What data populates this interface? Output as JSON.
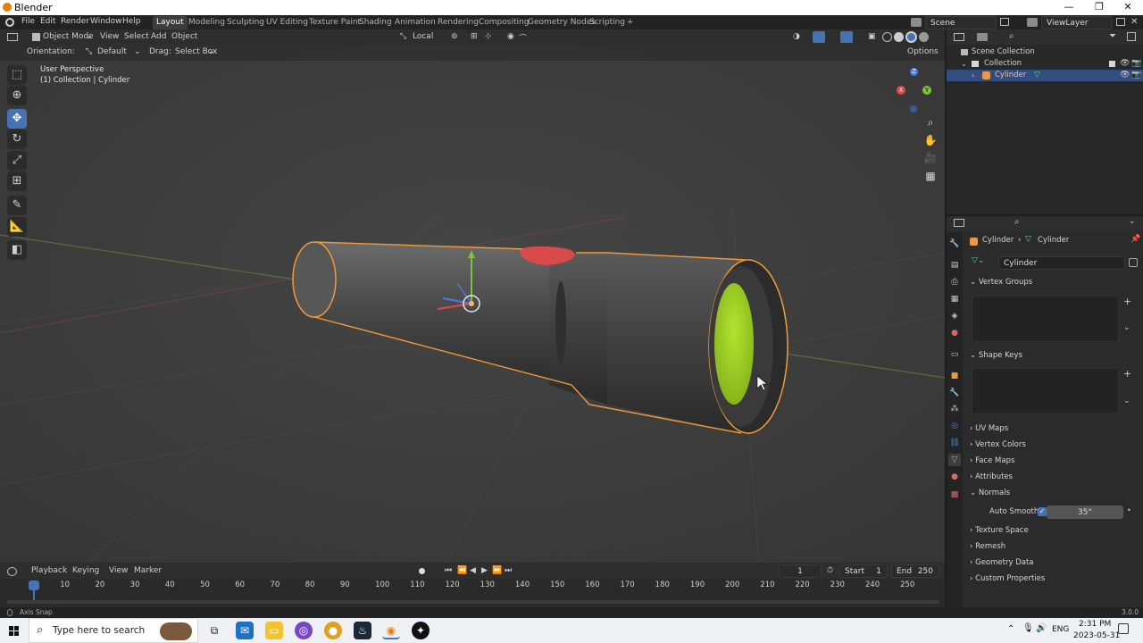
{
  "window": {
    "title": "Blender",
    "minimize": "—",
    "restore": "❐",
    "close": "✕"
  },
  "menu": [
    "File",
    "Edit",
    "Render",
    "Window",
    "Help"
  ],
  "workspaces": [
    {
      "label": "Layout",
      "active": true
    },
    {
      "label": "Modeling"
    },
    {
      "label": "Sculpting"
    },
    {
      "label": "UV Editing"
    },
    {
      "label": "Texture Paint"
    },
    {
      "label": "Shading"
    },
    {
      "label": "Animation"
    },
    {
      "label": "Rendering"
    },
    {
      "label": "Compositing"
    },
    {
      "label": "Geometry Nodes"
    },
    {
      "label": "Scripting"
    }
  ],
  "add_workspace": "+",
  "scene": {
    "label": "Scene",
    "view_layer": "ViewLayer"
  },
  "viewport_header": {
    "mode": "Object Mode",
    "menus": [
      "View",
      "Select",
      "Add",
      "Object"
    ],
    "transform_orientation": "Local",
    "orientation_label": "Orientation:",
    "orientation_value": "Default",
    "drag_label": "Drag:",
    "drag_value": "Select Box",
    "options": "Options"
  },
  "viewport_overlay": {
    "perspective": "User Perspective",
    "collection": "(1) Collection | Cylinder"
  },
  "gizmo": {
    "x": "X",
    "y": "Y",
    "z": "Z"
  },
  "outliner": {
    "rows": [
      {
        "label": "Scene Collection"
      },
      {
        "label": "Collection"
      },
      {
        "label": "Cylinder",
        "selected": true
      }
    ]
  },
  "properties": {
    "breadcrumb_object": "Cylinder",
    "breadcrumb_data": "Cylinder",
    "mesh_name": "Cylinder",
    "panels": {
      "vertex_groups": "Vertex Groups",
      "shape_keys": "Shape Keys",
      "uv_maps": "UV Maps",
      "vertex_colors": "Vertex Colors",
      "face_maps": "Face Maps",
      "attributes": "Attributes",
      "normals": "Normals",
      "auto_smooth": "Auto Smooth",
      "auto_smooth_angle": "35°",
      "texture_space": "Texture Space",
      "remesh": "Remesh",
      "geometry_data": "Geometry Data",
      "custom_properties": "Custom Properties"
    }
  },
  "timeline": {
    "menus": [
      "Playback",
      "Keying",
      "View",
      "Marker"
    ],
    "current_frame": "1",
    "start_label": "Start",
    "start": "1",
    "end_label": "End",
    "end": "250",
    "ticks": [
      "1",
      "10",
      "20",
      "30",
      "40",
      "50",
      "60",
      "70",
      "80",
      "90",
      "100",
      "110",
      "120",
      "130",
      "140",
      "150",
      "160",
      "170",
      "180",
      "190",
      "200",
      "210",
      "220",
      "230",
      "240",
      "250"
    ]
  },
  "status": {
    "left": "Axis Snap",
    "version": "3.0.0"
  },
  "taskbar": {
    "search_placeholder": "Type here to search",
    "language": "ENG",
    "time": "2:31 PM",
    "date": "2023-05-31"
  },
  "colors": {
    "accent": "#4772b3",
    "selection_outline": "#f29a3a",
    "lens_green": "#a6d428",
    "button_red": "#d94a4a"
  }
}
